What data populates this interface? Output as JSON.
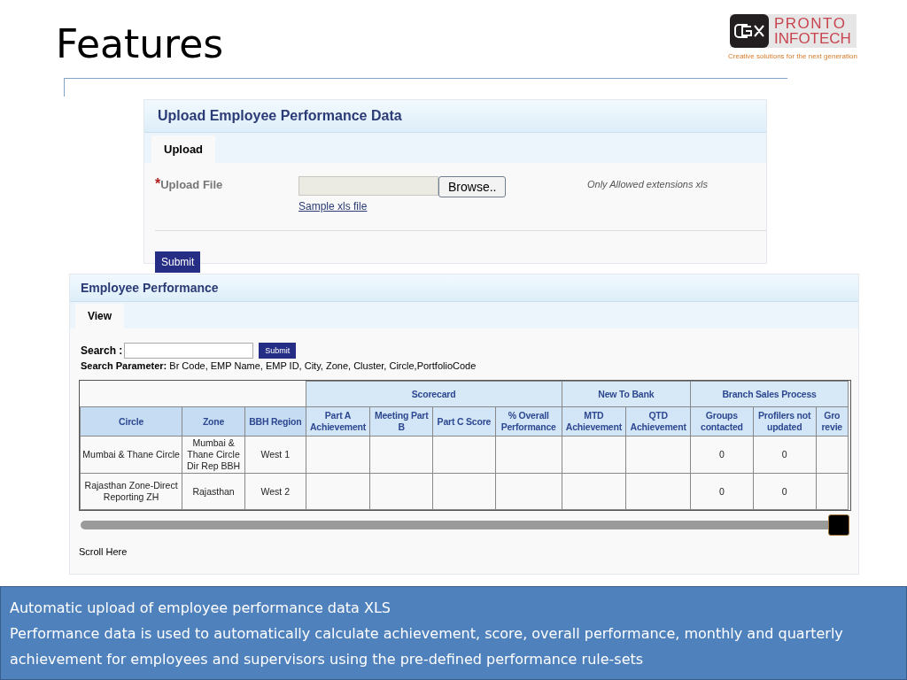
{
  "slide": {
    "title": "Features",
    "logo": {
      "name_line_1": "PRONTO",
      "name_line_2": "INFOTECH",
      "tagline": "Creative solutions for the next generation"
    }
  },
  "upload_panel": {
    "title": "Upload Employee Performance Data",
    "tabs": [
      {
        "label": "Upload",
        "selected": true
      }
    ],
    "required_mark": "*",
    "field_label": "Upload File",
    "browse_button": "Browse..",
    "sample_link": "Sample xls file",
    "hint": "Only Allowed extensions xls",
    "submit_button": "Submit"
  },
  "performance_panel": {
    "title": "Employee Performance",
    "tabs": [
      {
        "label": "View",
        "selected": true
      }
    ],
    "search_label": "Search :",
    "submit_button": "Submit",
    "search_parameter": "**Search Parameter:** Br Code, EMP Name, EMP ID, City, Zone, Cluster, Circle,PortfolioCode",
    "table": {
      "groups": [
        "Scorecard",
        "New To Bank",
        "Branch Sales Process"
      ],
      "columns": [
        "Circle",
        "Zone",
        "BBH Region",
        "Part A Achievement",
        "Meeting Part B",
        "Part C Score",
        "% Overall Performance",
        "MTD Achievement",
        "QTD Achievement",
        "Groups contacted",
        "Profilers not updated",
        "Gro revie"
      ],
      "rows": [
        [
          "Mumbai & Thane Circle",
          "Mumbai & Thane Circle Dir Rep BBH",
          "West 1",
          "",
          "",
          "",
          "",
          "",
          "",
          "0",
          "0",
          ""
        ],
        [
          "Rajasthan Zone-Direct Reporting ZH",
          "Rajasthan",
          "West 2",
          "",
          "",
          "",
          "",
          "",
          "",
          "0",
          "0",
          ""
        ]
      ]
    },
    "scroll_label": "Scroll Here"
  },
  "bullets": [
    "Automatic upload of employee performance data XLS",
    "Performance data is used to automatically calculate achievement, score, overall performance, monthly and quarterly achievement for employees and supervisors using the pre-defined performance rule-sets"
  ]
}
